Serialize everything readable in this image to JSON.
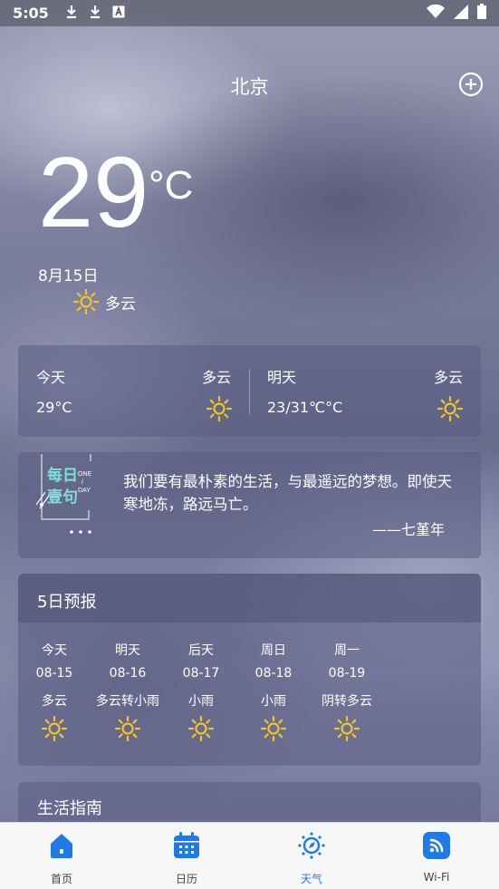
{
  "status_bar": {
    "time": "5:05"
  },
  "header": {
    "city": "北京"
  },
  "current": {
    "temperature": "29",
    "unit": "°C",
    "date": "8月15日",
    "condition": "多云"
  },
  "today_card": {
    "today_label": "今天",
    "today_condition": "多云",
    "today_temp": "29°C",
    "tomorrow_label": "明天",
    "tomorrow_condition": "多云",
    "tomorrow_temp": "23/31℃°C"
  },
  "quote_card": {
    "logo_text": "每日壹句",
    "logo_sub": "ONE / DAY",
    "text": "我们要有最朴素的生活，与最遥远的梦想。即使天寒地冻，路远马亡。",
    "author": "——七堇年"
  },
  "forecast": {
    "title": "5日预报",
    "days": [
      {
        "name": "今天",
        "date": "08-15",
        "condition": "多云"
      },
      {
        "name": "明天",
        "date": "08-16",
        "condition": "多云转小雨"
      },
      {
        "name": "后天",
        "date": "08-17",
        "condition": "小雨"
      },
      {
        "name": "周日",
        "date": "08-18",
        "condition": "小雨"
      },
      {
        "name": "周一",
        "date": "08-19",
        "condition": "阴转多云"
      }
    ]
  },
  "life_guide": {
    "title": "生活指南"
  },
  "tabs": [
    {
      "label": "首页",
      "icon": "home-icon"
    },
    {
      "label": "日历",
      "icon": "calendar-icon"
    },
    {
      "label": "天气",
      "icon": "compass-icon"
    },
    {
      "label": "Wi-Fi",
      "icon": "wifi-icon"
    }
  ],
  "colors": {
    "accent": "#1f7ae8",
    "sun": "#f3c623"
  }
}
